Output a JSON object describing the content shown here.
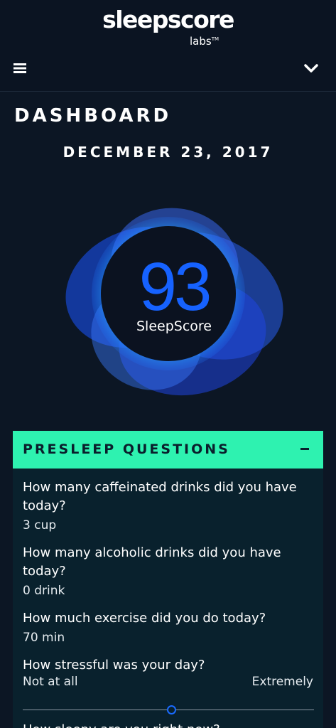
{
  "header": {
    "logo_main": "sleepscore",
    "logo_sub": "labs",
    "logo_tm": "TM"
  },
  "page_title": "DASHBOARD",
  "date": "DECEMBER 23, 2017",
  "score": {
    "value": "93",
    "label": "SleepScore"
  },
  "panel": {
    "title": "PRESLEEP QUESTIONS",
    "questions": [
      {
        "q": "How many caffeinated drinks did you have today?",
        "a": "3 cup"
      },
      {
        "q": "How many alcoholic drinks did you have today?",
        "a": "0 drink"
      },
      {
        "q": "How much exercise did you do today?",
        "a": "70 min"
      },
      {
        "q": "How stressful was your day?",
        "scale_min": "Not at all",
        "scale_max": "Extremely",
        "level": 0.51
      },
      {
        "q": "How sleepy are you right now?"
      }
    ]
  },
  "colors": {
    "accent": "#2ef2b0",
    "score_blue": "#1662ff",
    "background": "#0c1624",
    "panel": "#09212d"
  }
}
